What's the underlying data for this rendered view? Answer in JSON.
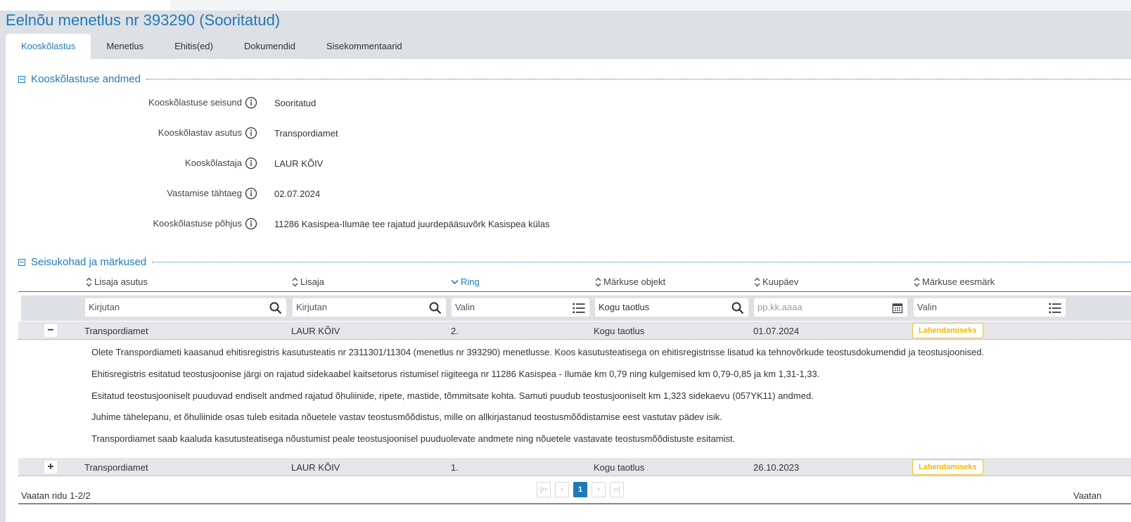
{
  "page": {
    "title": "Eelnõu menetlus nr 393290 (Sooritatud)"
  },
  "tabs": [
    {
      "label": "Kooskõlastus",
      "active": true
    },
    {
      "label": "Menetlus"
    },
    {
      "label": "Ehitis(ed)"
    },
    {
      "label": "Dokumendid"
    },
    {
      "label": "Sisekommentaarid"
    }
  ],
  "details_section": {
    "title": "Kooskõlastuse andmed",
    "fields": [
      {
        "label": "Kooskõlastuse seisund",
        "value": "Sooritatud"
      },
      {
        "label": "Kooskõlastav asutus",
        "value": "Transpordiamet"
      },
      {
        "label": "Kooskõlastaja",
        "value": "LAUR KÕIV"
      },
      {
        "label": "Vastamise tähtaeg",
        "value": "02.07.2024"
      },
      {
        "label": "Kooskõlastuse põhjus",
        "value": "11286 Kasispea-Ilumäe tee rajatud juurdepääsuvõrk Kasispea külas"
      }
    ]
  },
  "remarks_section": {
    "title": "Seisukohad ja märkused",
    "columns": [
      "Lisaja asutus",
      "Lisaja",
      "Ring",
      "Märkuse objekt",
      "Kuupäev",
      "Märkuse eesmärk"
    ],
    "filters": {
      "asutus": "Kirjutan",
      "lisaja": "Kirjutan",
      "ring": "Valin",
      "objekt": "Kogu taotlus",
      "kuupaev": "pp.kk.aaaa",
      "eesmark": "Valin"
    },
    "rows": [
      {
        "toggle": "−",
        "asutus": "Transpordiamet",
        "lisaja": "LAUR KÕIV",
        "ring": "2.",
        "objekt": "Kogu taotlus",
        "kuupaev": "01.07.2024",
        "eesmark": "Lahendamiseks",
        "comments": [
          "Olete Transpordiameti kaasanud ehitisregistris kasutusteatis nr 2311301/11304 (menetlus nr 393290) menetlusse. Koos kasutusteatisega on ehitisregistrisse lisatud ka tehnovõrkude teostusdokumendid ja teostusjoonised.",
          "Ehitisregistris esitatud teostusjoonise järgi on rajatud sidekaabel kaitsetorus ristumisel riigiteega nr 11286 Kasispea - Ilumäe km 0,79 ning kulgemised km 0,79-0,85 ja km 1,31-1,33.",
          "Esitatud teostusjooniselt puuduvad endiselt andmed rajatud õhuliinide, ripete, mastide, tõmmitsate kohta. Samuti puudub teostusjooniselt km 1,323 sidekaevu (057YK11) andmed.",
          "Juhime tähelepanu, et õhuliinide osas tuleb esitada nõuetele vastav teostusmõõdistus, mille on allkirjastanud teostusmõõdistamise eest vastutav pädev isik.",
          "Transpordiamet saab kaaluda kasutusteatisega nõustumist peale teostusjoonisel puuduolevate andmete ning nõuetele vastavate teostusmõõdistuste esitamist."
        ]
      },
      {
        "toggle": "+",
        "asutus": "Transpordiamet",
        "lisaja": "LAUR KÕIV",
        "ring": "1.",
        "objekt": "Kogu taotlus",
        "kuupaev": "26.10.2023",
        "eesmark": "Lahendamiseks"
      }
    ],
    "footer": {
      "rows_info": "Vaatan ridu 1-2/2",
      "right_text": "Vaatan",
      "current_page": "1",
      "pager_first": "|‹‹",
      "pager_prev": "‹",
      "pager_next": "›",
      "pager_last": "››|"
    }
  },
  "colors": {
    "accent": "#1f7ab8",
    "badge": "#f2b705",
    "background": "#dde0e4"
  }
}
